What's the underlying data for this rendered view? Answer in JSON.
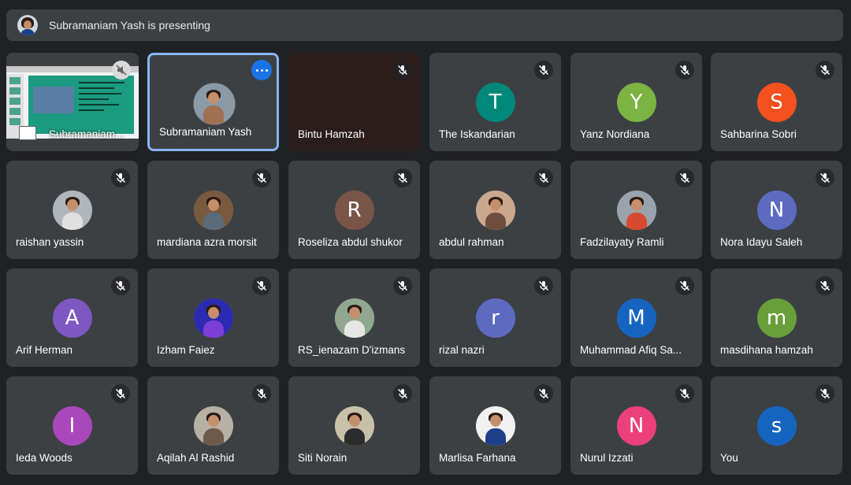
{
  "banner": {
    "text": "Subramaniam Yash is presenting"
  },
  "screen_share": {
    "label": "Subramaniam..."
  },
  "participants": [
    {
      "name": "Subramaniam Yash",
      "avatar": "photo",
      "active": true
    },
    {
      "name": "Bintu Hamzah",
      "avatar": "none",
      "muted": true
    },
    {
      "name": "The Iskandarian",
      "initial": "T",
      "color": "#00897b",
      "muted": true
    },
    {
      "name": "Yanz Nordiana",
      "initial": "Y",
      "color": "#7cb342",
      "muted": true
    },
    {
      "name": "Sahbarina Sobri",
      "initial": "S",
      "color": "#f4511e",
      "muted": true
    },
    {
      "name": "raishan yassin",
      "avatar": "photo",
      "muted": true
    },
    {
      "name": "mardiana azra morsit",
      "avatar": "photo",
      "muted": true
    },
    {
      "name": "Roseliza abdul shukor",
      "initial": "R",
      "color": "#795548",
      "muted": true
    },
    {
      "name": "abdul rahman",
      "avatar": "photo",
      "muted": true
    },
    {
      "name": "Fadzilayaty Ramli",
      "avatar": "photo",
      "muted": true
    },
    {
      "name": "Nora Idayu Saleh",
      "initial": "N",
      "color": "#5c6bc0",
      "muted": true
    },
    {
      "name": "Arif Herman",
      "initial": "A",
      "color": "#7e57c2",
      "muted": true
    },
    {
      "name": "Izham Faiez",
      "avatar": "photo",
      "muted": true
    },
    {
      "name": "RS_ienazam D'izmans",
      "avatar": "photo",
      "muted": true
    },
    {
      "name": "rizal nazri",
      "initial": "r",
      "color": "#5c6bc0",
      "muted": true
    },
    {
      "name": "Muhammad Afiq Sa...",
      "initial": "M",
      "color": "#1565c0",
      "muted": true
    },
    {
      "name": "masdihana hamzah",
      "initial": "m",
      "color": "#689f38",
      "muted": true
    },
    {
      "name": "Ieda Woods",
      "initial": "I",
      "color": "#ab47bc",
      "muted": true
    },
    {
      "name": "Aqilah Al Rashid",
      "avatar": "photo",
      "muted": true
    },
    {
      "name": "Siti Norain",
      "avatar": "photo",
      "muted": true
    },
    {
      "name": "Marlisa Farhana",
      "avatar": "photo",
      "muted": true
    },
    {
      "name": "Nurul Izzati",
      "initial": "N",
      "color": "#ec407a",
      "muted": true
    },
    {
      "name": "You",
      "initial": "s",
      "color": "#1565c0",
      "muted": true
    }
  ],
  "icons": {
    "mic_off": "mic-off-icon",
    "more": "more-options-icon"
  }
}
